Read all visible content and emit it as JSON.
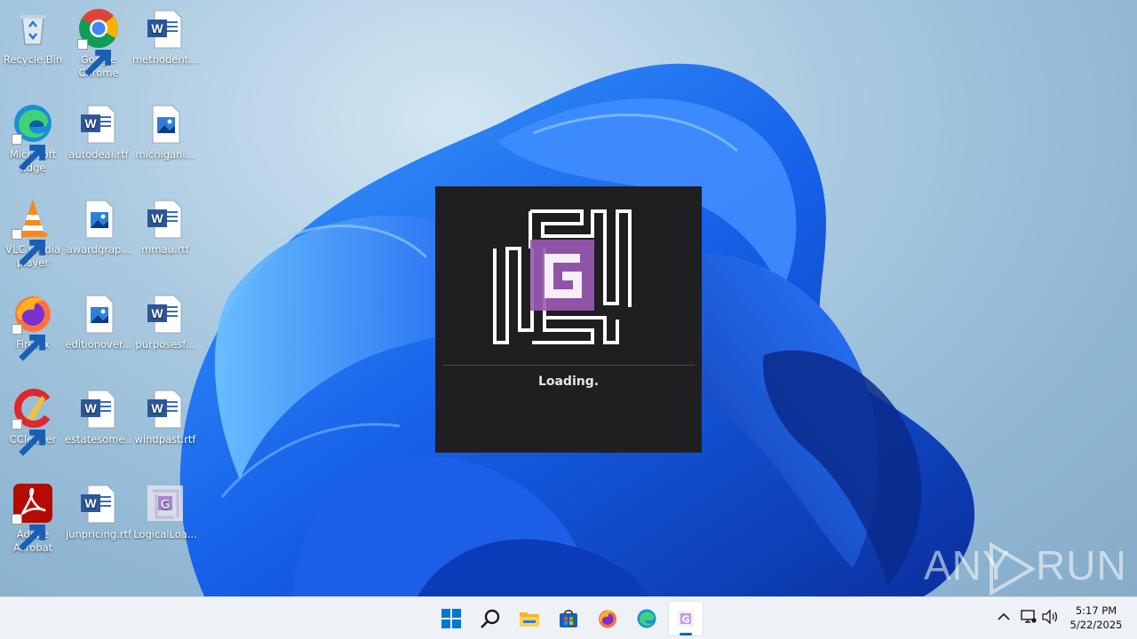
{
  "desktop": {
    "icons": [
      {
        "label": "Recycle Bin",
        "icon": "recycle-bin-icon"
      },
      {
        "label": "Google Chrome",
        "icon": "chrome-icon"
      },
      {
        "label": "methodent...",
        "icon": "word-document-icon"
      },
      {
        "label": "Microsoft Edge",
        "icon": "edge-icon"
      },
      {
        "label": "autodeal.rtf",
        "icon": "word-document-icon"
      },
      {
        "label": "michiganl...",
        "icon": "image-file-icon"
      },
      {
        "label": "VLC media player",
        "icon": "vlc-icon"
      },
      {
        "label": "awardgrap...",
        "icon": "image-file-icon"
      },
      {
        "label": "mmau.rtf",
        "icon": "word-document-icon"
      },
      {
        "label": "Firefox",
        "icon": "firefox-icon"
      },
      {
        "label": "editionover...",
        "icon": "image-file-icon"
      },
      {
        "label": "purposesf...",
        "icon": "word-document-icon"
      },
      {
        "label": "CCleaner",
        "icon": "ccleaner-icon"
      },
      {
        "label": "estatesome...",
        "icon": "word-document-icon"
      },
      {
        "label": "windpast.rtf",
        "icon": "word-document-icon"
      },
      {
        "label": "Adobe Acrobat",
        "icon": "acrobat-icon"
      },
      {
        "label": "junpricing.rtf",
        "icon": "word-document-icon"
      },
      {
        "label": "LogicalLoa...",
        "icon": "logicalloader-app-icon"
      }
    ]
  },
  "loader": {
    "status_text": "Loading.",
    "logo_icon": "logicalloader-maze-logo",
    "logo_letter": "G",
    "accent_color": "#9b59b6"
  },
  "watermark": {
    "part1": "ANY",
    "part2": "RUN"
  },
  "taskbar": {
    "buttons": [
      {
        "name": "start",
        "icon": "windows-start-icon"
      },
      {
        "name": "search",
        "icon": "search-icon"
      },
      {
        "name": "file-explorer",
        "icon": "folder-icon"
      },
      {
        "name": "microsoft-store",
        "icon": "store-icon"
      },
      {
        "name": "firefox",
        "icon": "firefox-icon"
      },
      {
        "name": "edge",
        "icon": "edge-icon"
      },
      {
        "name": "logicalloader",
        "icon": "logicalloader-app-icon",
        "active": true
      }
    ],
    "tray": {
      "chevron_icon": "chevron-up-icon",
      "network_icon": "network-icon",
      "volume_icon": "speaker-icon"
    },
    "clock": {
      "time": "5:17 PM",
      "date": "5/22/2025"
    }
  },
  "colors": {
    "accent": "#0067c0",
    "loader_bg": "#1f1f22",
    "taskbar_bg": "#eef1f5"
  }
}
